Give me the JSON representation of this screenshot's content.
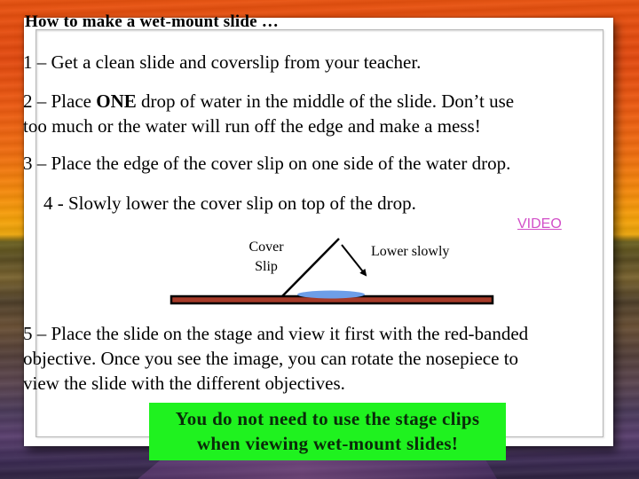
{
  "slide": {
    "title": "How to make a wet-mount slide …",
    "steps": {
      "step1": "1 – Get a clean slide and coverslip from your teacher.",
      "step2_prefix": "2 – Place ",
      "step2_bold": "ONE",
      "step2_line1_rest": " drop of water in the middle of the slide.  Don’t use",
      "step2_line2": "too much or the water will run off the edge and make a mess!",
      "step3": "3 – Place the edge of the cover slip on one side of the water drop.",
      "step4": "4 - Slowly lower the cover slip on top of the drop.",
      "step5_line1": "5 – Place the slide on the stage and view it first with the red-banded",
      "step5_line2": "objective. Once you see the image, you can rotate the nosepiece to",
      "step5_line3": "view the slide with the different objectives."
    },
    "video_link": "VIDEO",
    "diagram": {
      "label_cover_line1": "Cover",
      "label_cover_line2": "Slip",
      "label_lower": "Lower slowly",
      "colors": {
        "slide_fill": "#a63a28",
        "slide_outline": "#000000",
        "water_drop": "#6d9ee8",
        "cover_slip": "#000000"
      }
    },
    "note": {
      "line1": "You do not need to use the stage clips",
      "line2": "when viewing wet-mount slides!",
      "background": "#1ff21f"
    },
    "colors": {
      "link": "#d24fc8",
      "frame": "#ffffff"
    }
  }
}
